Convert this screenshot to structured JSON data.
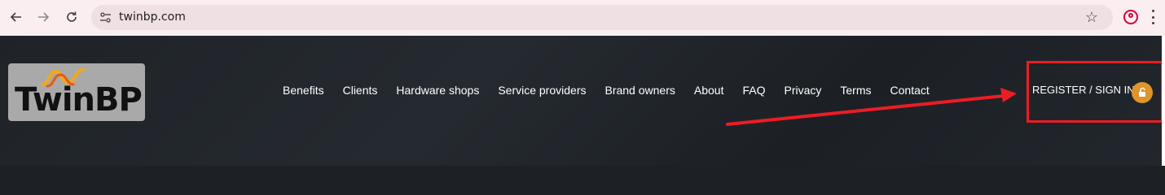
{
  "browser": {
    "back_icon": "arrow-left-icon",
    "forward_icon": "arrow-right-icon",
    "reload_icon": "reload-icon",
    "url": "twinbp.com",
    "bookmark_icon": "star-icon",
    "profile_icon": "profile-icon",
    "menu_icon": "kebab-menu-icon"
  },
  "header": {
    "logo_text": "TwinBP",
    "nav": [
      "Benefits",
      "Clients",
      "Hardware shops",
      "Service providers",
      "Brand owners",
      "About",
      "FAQ",
      "Privacy",
      "Terms",
      "Contact"
    ],
    "register_label": "REGISTER / SIGN IN",
    "lock_icon": "unlock-icon"
  },
  "annotation": {
    "color": "#ec1c24"
  },
  "colors": {
    "chrome_bg": "#fbeef0",
    "page_bg": "#1f2328",
    "lock_accent": "#e0942c"
  }
}
